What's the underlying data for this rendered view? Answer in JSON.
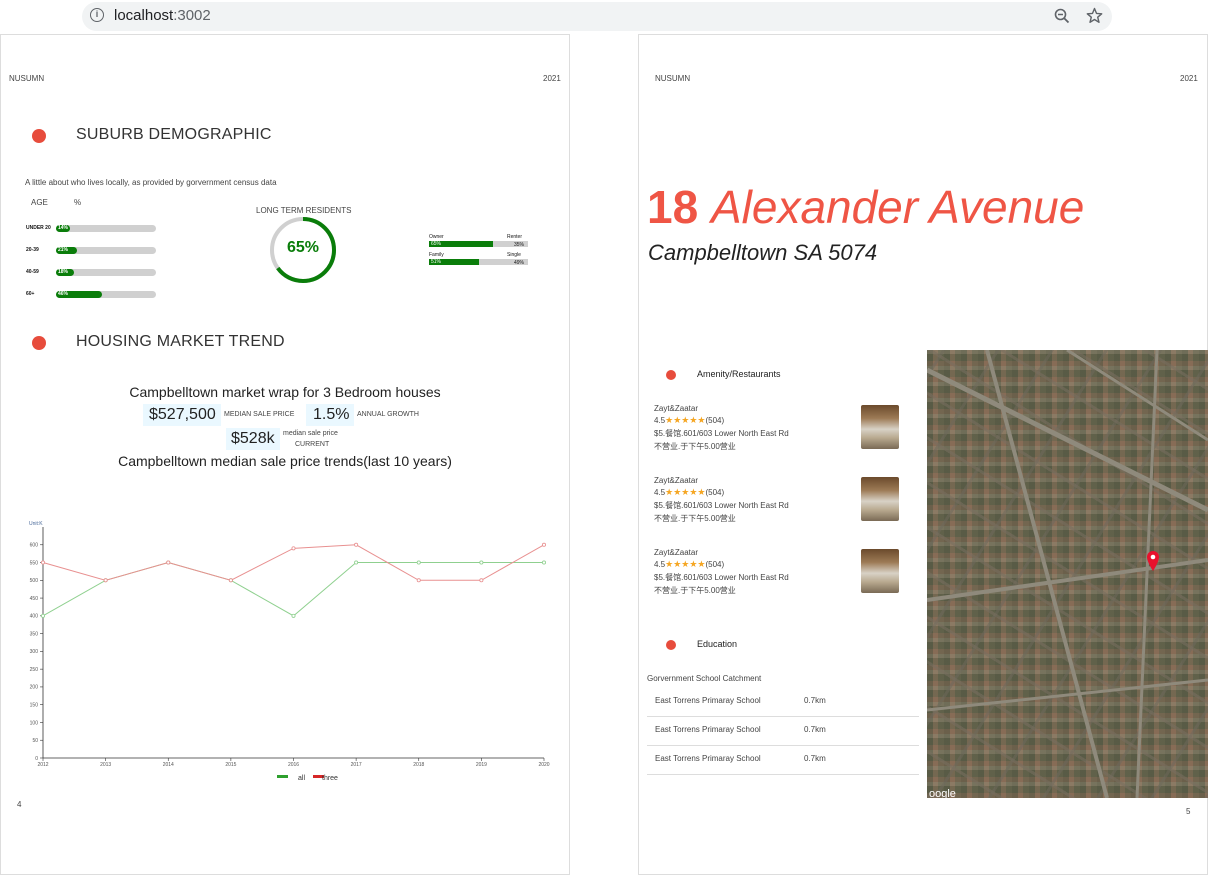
{
  "browser": {
    "url_host": "localhost",
    "url_port": ":3002"
  },
  "left_page": {
    "header_left": "NUSUMN",
    "header_right": "2021",
    "page_number": "4",
    "demographic": {
      "title": "SUBURB DEMOGRAPHIC",
      "subtitle": "A little about who lives locally, as provided by gorvernment census data",
      "age_header": "AGE",
      "pct_header": "%",
      "age_groups": [
        {
          "label": "UNDER 20",
          "value_label": "14%",
          "value": 0.14
        },
        {
          "label": "20-39",
          "value_label": "21%",
          "value": 0.21
        },
        {
          "label": "40-59",
          "value_label": "18%",
          "value": 0.18
        },
        {
          "label": "60+",
          "value_label": "46%",
          "value": 0.46
        }
      ],
      "long_term_label": "LONG TERM RESIDENTS",
      "long_term_value": "65%",
      "long_term_fraction": 0.65,
      "tenure": [
        {
          "left_label": "Owner",
          "right_label": "Renter",
          "left_value": "65%",
          "right_value": "35%",
          "fraction": 0.65
        },
        {
          "left_label": "Family",
          "right_label": "Single",
          "left_value": "51%",
          "right_value": "49%",
          "fraction": 0.51
        }
      ]
    },
    "market": {
      "title": "HOUSING MARKET TREND",
      "wrap_title": "Campbelltown market wrap for 3 Bedroom houses",
      "median_price": "$527,500",
      "median_price_label": "MEDIAN SALE PRICE",
      "growth": "1.5%",
      "growth_label": "ANNUAL GROWTH",
      "current_price": "$528k",
      "current_label_1": "median sale price",
      "current_label_2": "CURRENT",
      "trend_title": "Campbelltown median sale price trends(last 10 years)"
    }
  },
  "chart_data": {
    "type": "line",
    "ylabel": "Unit:K",
    "ylim": [
      0,
      650
    ],
    "yticks": [
      "0",
      "50",
      "100",
      "150",
      "200",
      "250",
      "300",
      "350",
      "400",
      "450",
      "500",
      "550",
      "600"
    ],
    "x": [
      "2012",
      "2013",
      "2014",
      "2015",
      "2016",
      "2017",
      "2018",
      "2019",
      "2020"
    ],
    "series": [
      {
        "name": "all",
        "color": "#2ea02e",
        "values": [
          400,
          500,
          550,
          500,
          400,
          550,
          550,
          550,
          550
        ]
      },
      {
        "name": "three",
        "color": "#d62728",
        "values": [
          550,
          500,
          550,
          500,
          590,
          600,
          500,
          500,
          600
        ]
      }
    ],
    "grid": false,
    "legend": "bottom"
  },
  "right_page": {
    "header_left": "NUSUMN",
    "header_right": "2021",
    "page_number": "5",
    "street_number": "18",
    "street_name": "Alexander Avenue",
    "suburb": "Campbelltown SA 5074",
    "accent_color": "#ef5545",
    "amenity_title": "Amenity/Restaurants",
    "restaurants": [
      {
        "name": "Zayt&Zaatar",
        "rating": "4.5",
        "stars": "★★★★★",
        "reviews": "(504)",
        "address": "$5.餐馆.601/603 Lower North East Rd",
        "hours": "不营业.于下午5.00营业"
      },
      {
        "name": "Zayt&Zaatar",
        "rating": "4.5",
        "stars": "★★★★★",
        "reviews": "(504)",
        "address": "$5.餐馆.601/603 Lower North East Rd",
        "hours": "不营业.于下午5.00营业"
      },
      {
        "name": "Zayt&Zaatar",
        "rating": "4.5",
        "stars": "★★★★★",
        "reviews": "(504)",
        "address": "$5.餐馆.601/603 Lower North East Rd",
        "hours": "不营业.于下午5.00营业"
      }
    ],
    "education_title": "Education",
    "catchment_label": "Gorvernment School Catchment",
    "schools": [
      {
        "name": "East Torrens Primaray School",
        "distance": "0.7km"
      },
      {
        "name": "East Torrens Primaray School",
        "distance": "0.7km"
      },
      {
        "name": "East Torrens Primaray School",
        "distance": "0.7km"
      }
    ],
    "map_watermark": "oogle"
  }
}
